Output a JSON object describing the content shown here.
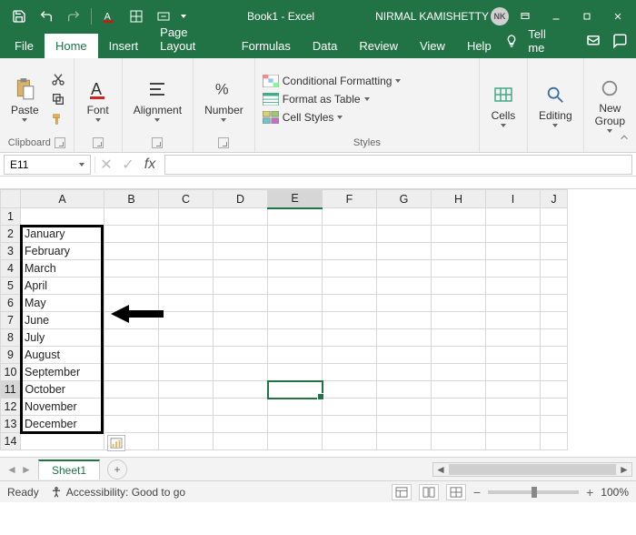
{
  "titlebar": {
    "title": "Book1 - Excel",
    "username": "NIRMAL KAMISHETTY",
    "initials": "NK"
  },
  "tabs": {
    "file": "File",
    "home": "Home",
    "insert": "Insert",
    "pagelayout": "Page Layout",
    "formulas": "Formulas",
    "data": "Data",
    "review": "Review",
    "view": "View",
    "help": "Help",
    "tellme": "Tell me"
  },
  "ribbon": {
    "clipboard": {
      "label": "Clipboard",
      "paste": "Paste"
    },
    "font": {
      "label": "Font"
    },
    "alignment": {
      "label": "Alignment"
    },
    "number": {
      "label": "Number"
    },
    "styles": {
      "label": "Styles",
      "cond": "Conditional Formatting",
      "table": "Format as Table",
      "cell": "Cell Styles"
    },
    "cells": {
      "label": "Cells"
    },
    "editing": {
      "label": "Editing"
    },
    "newgroup": {
      "label": "New\nGroup"
    }
  },
  "formula": {
    "namebox": "E11",
    "fx": "fx"
  },
  "columns": [
    "A",
    "B",
    "C",
    "D",
    "E",
    "F",
    "G",
    "H",
    "I",
    "J"
  ],
  "rows": [
    "1",
    "2",
    "3",
    "4",
    "5",
    "6",
    "7",
    "8",
    "9",
    "10",
    "11",
    "12",
    "13",
    "14"
  ],
  "cells": {
    "A2": "January",
    "A3": "February",
    "A4": "March",
    "A5": "April",
    "A6": "May",
    "A7": "June",
    "A8": "July",
    "A9": "August",
    "A10": "September",
    "A11": "October",
    "A12": "November",
    "A13": "December"
  },
  "selected_cell": "E11",
  "sheet": {
    "active": "Sheet1"
  },
  "status": {
    "ready": "Ready",
    "accessibility": "Accessibility: Good to go",
    "zoom": "100%"
  }
}
